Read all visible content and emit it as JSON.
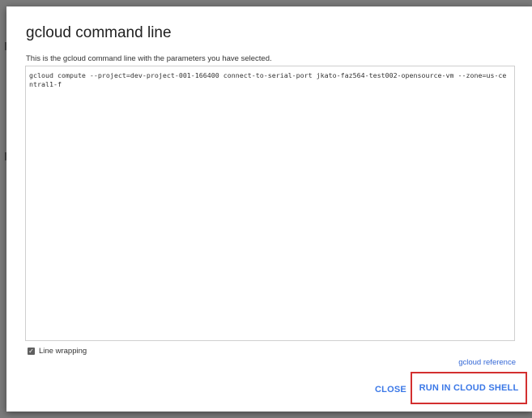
{
  "dialog": {
    "title": "gcloud command line",
    "description": "This is the gcloud command line with the parameters you have selected.",
    "command": "gcloud compute --project=dev-project-001-166400 connect-to-serial-port jkato-faz564-test002-opensource-vm --zone=us-central1-f",
    "line_wrapping_label": "Line wrapping",
    "line_wrapping_checked": true,
    "checkbox_mark": "✓",
    "reference_link": "gcloud reference",
    "close_label": "CLOSE",
    "run_label": "RUN IN CLOUD SHELL"
  },
  "colors": {
    "accent": "#3b78e7",
    "highlight": "#d32f2f",
    "overlay": "#7a7a7a"
  }
}
